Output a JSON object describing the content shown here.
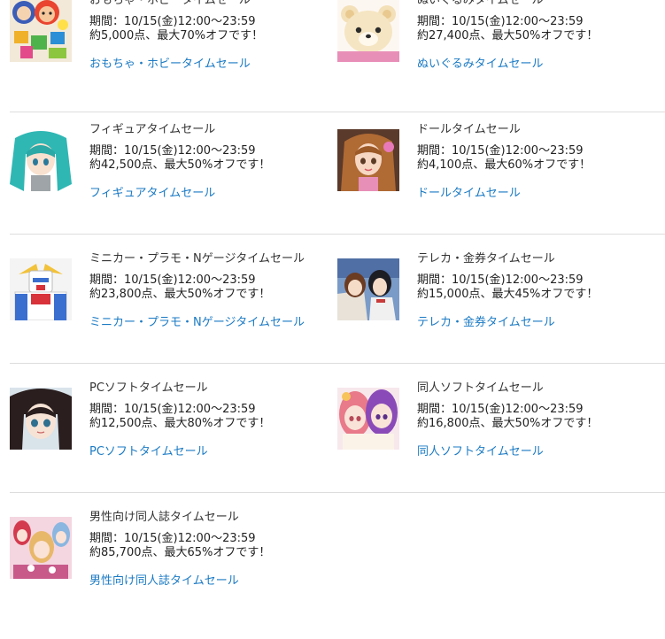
{
  "sales": [
    {
      "title": "おもちゃ・ホビータイムセール",
      "period": "期間：10/15(金)12:00〜23:59",
      "summary": "約5,000点、最大70%オフです！",
      "link": "おもちゃ・ホビータイムセール"
    },
    {
      "title": "ぬいぐるみタイムセール",
      "period": "期間：10/15(金)12:00〜23:59",
      "summary": "約27,400点、最大50%オフです！",
      "link": "ぬいぐるみタイムセール"
    },
    {
      "title": "フィギュアタイムセール",
      "period": "期間：10/15(金)12:00〜23:59",
      "summary": "約42,500点、最大50%オフです！",
      "link": "フィギュアタイムセール"
    },
    {
      "title": "ドールタイムセール",
      "period": "期間：10/15(金)12:00〜23:59",
      "summary": "約4,100点、最大60%オフです！",
      "link": "ドールタイムセール"
    },
    {
      "title": "ミニカー・プラモ・Nゲージタイムセール",
      "period": "期間：10/15(金)12:00〜23:59",
      "summary": "約23,800点、最大50%オフです！",
      "link": "ミニカー・プラモ・Nゲージタイムセール"
    },
    {
      "title": "テレカ・金券タイムセール",
      "period": "期間：10/15(金)12:00〜23:59",
      "summary": "約15,000点、最大45%オフです！",
      "link": "テレカ・金券タイムセール"
    },
    {
      "title": "PCソフトタイムセール",
      "period": "期間：10/15(金)12:00〜23:59",
      "summary": "約12,500点、最大80%オフです！",
      "link": "PCソフトタイムセール"
    },
    {
      "title": "同人ソフトタイムセール",
      "period": "期間：10/15(金)12:00〜23:59",
      "summary": "約16,800点、最大50%オフです！",
      "link": "同人ソフトタイムセール"
    },
    {
      "title": "男性向け同人誌タイムセール",
      "period": "期間：10/15(金)12:00〜23:59",
      "summary": "約85,700点、最大65%オフです！",
      "link": "男性向け同人誌タイムセール"
    }
  ],
  "colors": {
    "link": "#1a7ac4",
    "text": "#333333",
    "divider": "#dddddd"
  },
  "icons": [
    "toys-thumbnail-icon",
    "plush-bear-thumbnail-icon",
    "figure-thumbnail-icon",
    "doll-thumbnail-icon",
    "robot-model-thumbnail-icon",
    "telecard-thumbnail-icon",
    "pc-software-thumbnail-icon",
    "doujin-software-thumbnail-icon",
    "doujinshi-thumbnail-icon"
  ]
}
